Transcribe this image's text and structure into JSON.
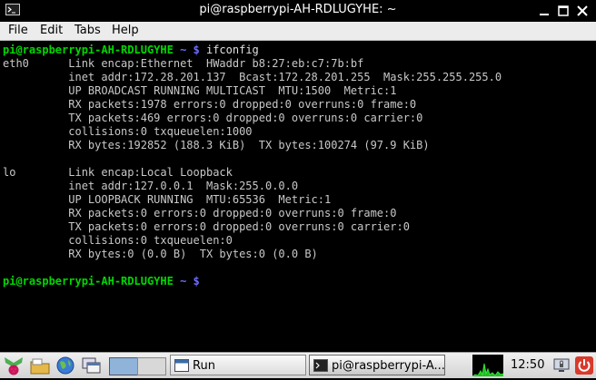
{
  "window": {
    "title": "pi@raspberrypi-AH-RDLUGYHE: ~"
  },
  "menu": {
    "items": [
      "File",
      "Edit",
      "Tabs",
      "Help"
    ]
  },
  "terminal": {
    "prompt_user": "pi@raspberrypi-AH-RDLUGYHE",
    "prompt_path": " ~ $",
    "command": " ifconfig",
    "output": [
      "eth0      Link encap:Ethernet  HWaddr b8:27:eb:c7:7b:bf",
      "          inet addr:172.28.201.137  Bcast:172.28.201.255  Mask:255.255.255.0",
      "          UP BROADCAST RUNNING MULTICAST  MTU:1500  Metric:1",
      "          RX packets:1978 errors:0 dropped:0 overruns:0 frame:0",
      "          TX packets:469 errors:0 dropped:0 overruns:0 carrier:0",
      "          collisions:0 txqueuelen:1000",
      "          RX bytes:192852 (188.3 KiB)  TX bytes:100274 (97.9 KiB)",
      "",
      "lo        Link encap:Local Loopback",
      "          inet addr:127.0.0.1  Mask:255.0.0.0",
      "          UP LOOPBACK RUNNING  MTU:65536  Metric:1",
      "          RX packets:0 errors:0 dropped:0 overruns:0 frame:0",
      "          TX packets:0 errors:0 dropped:0 overruns:0 carrier:0",
      "          collisions:0 txqueuelen:0",
      "          RX bytes:0 (0.0 B)  TX bytes:0 (0.0 B)",
      ""
    ]
  },
  "taskbar": {
    "tasks": [
      {
        "label": "Run",
        "icon": "window-icon"
      },
      {
        "label": "pi@raspberrypi-A...",
        "icon": "terminal-icon"
      }
    ],
    "clock": "12:50"
  }
}
